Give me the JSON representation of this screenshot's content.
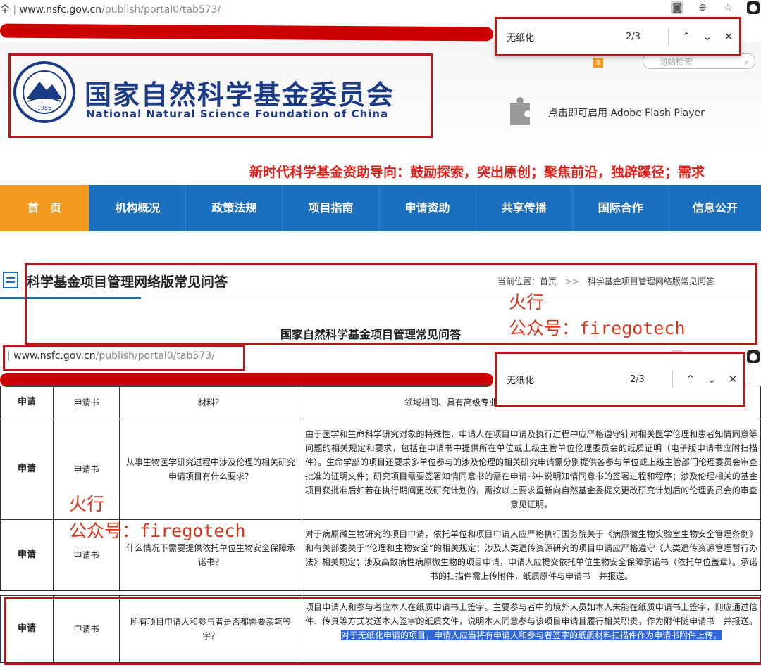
{
  "top_browser": {
    "url_prefix": "全",
    "url_domain": "www.nsfc.gov.cn",
    "url_path": "/publish/portal0/tab573/"
  },
  "find_bar_top": {
    "query": "无纸化",
    "count": "2/3"
  },
  "site": {
    "badge": "五",
    "search_placeholder": "网站检索",
    "flash_text": "点击即可启用 Adobe Flash Player",
    "logo_year": "1986",
    "title_cn": "国家自然科学基金委员会",
    "title_en": "National Natural Science Foundation of China",
    "slogan": "新时代科学基金资助导向：鼓励探索，突出原创；聚焦前沿，独辟蹊径；需求"
  },
  "nav": [
    "首　页",
    "机构概况",
    "政策法规",
    "项目指南",
    "申请资助",
    "共享传播",
    "国际合作",
    "信息公开"
  ],
  "section": {
    "title": "科学基金项目管理网络版常见问答",
    "breadcrumb_label": "当前位置：首页",
    "breadcrumb_sep": ">>",
    "breadcrumb_current": "科学基金项目管理网络版常见问答",
    "table_title": "国家自然科学基金项目管理常见问答"
  },
  "watermark": {
    "line1": "火行",
    "line2": "公众号：firegotech"
  },
  "second_browser": {
    "url_domain": "www.nsfc.gov.cn",
    "url_path": "/publish/portal0/tab573/"
  },
  "find_bar_bottom": {
    "query": "无纸化",
    "count": "2/3"
  },
  "table": {
    "partial_row": {
      "cat": "申请",
      "type": "申请书",
      "question": "材料？",
      "answer": "领域相同、具有高级专业技术职务（职称）的科学技术人员推荐信。"
    },
    "rows": [
      {
        "cat": "申请",
        "type": "申请书",
        "question": "从事生物医学研究过程中涉及伦理的相关研究申请项目有什么要求？",
        "answer": "由于医学和生命科学研究对象的特殊性，申请人在项目申请及执行过程中应严格遵守针对相关医学伦理和患者知情同意等问题的相关规定和要求，包括在申请书中提供所在单位或上级主管单位伦理委员会的纸质证明（电子版申请书应附扫描件）。生命学部的项目还要求多单位参与的涉及伦理的相关研究申请需分别提供各参与单位或上级主管部门伦理委员会审查批准的证明文件；研究项目需要签署知情同意书的需在申请书中说明知情同意书的签署过程和程序；涉及伦理相关的基金项目获批准后如若在执行期间更改研究计划的，需按以上要求重新向自然基金委提交更改研究计划后的伦理委员会的审查意见证明。"
      },
      {
        "cat": "申请",
        "type": "申请书",
        "question": "什么情况下需要提供依托单位生物安全保障承诺书？",
        "answer": "对于病原微生物研究的项目申请，依托单位和项目申请人应严格执行国务院关于《病原微生物实验室生物安全管理条例》和有关部委关于“伦理和生物安全”的相关规定；涉及人类遗传资源研究的项目申请应严格遵守《人类遗传资源管理暂行办法》相关规定；涉及高致病性病原微生物的项目申请，申请人应提交依托单位生物安全保障承诺书（依托单位盖章）。承诺书的扫描件需上传附件，纸质原件与申请书一并报送。"
      },
      {
        "cat": "申请",
        "type": "申请书",
        "question": "所有项目申请人和参与者是否都需要亲笔签字？",
        "answer_plain": "项目申请人和参与者应本人在纸质申请书上签字。主要参与者中的境外人员如本人未能在纸质申请书上签字，则应通过信件、传真等方式发送本人签字的纸质文件，说明本人同意参与该项目申请且履行相关职责，作为附件随申请书一并报送。",
        "answer_highlight": "对于无纸化申请的项目，申请人应当将有申请人和参与者签字的纸质材料扫描件作为申请书附件上传。"
      }
    ]
  },
  "colors": {
    "brand_blue": "#1c3b86",
    "nav_blue": "#1b6fbf",
    "nav_home": "#f39a1f",
    "slogan_red": "#e0201b",
    "annotation_red": "#b51a1a",
    "highlight": "#2f66d8"
  }
}
